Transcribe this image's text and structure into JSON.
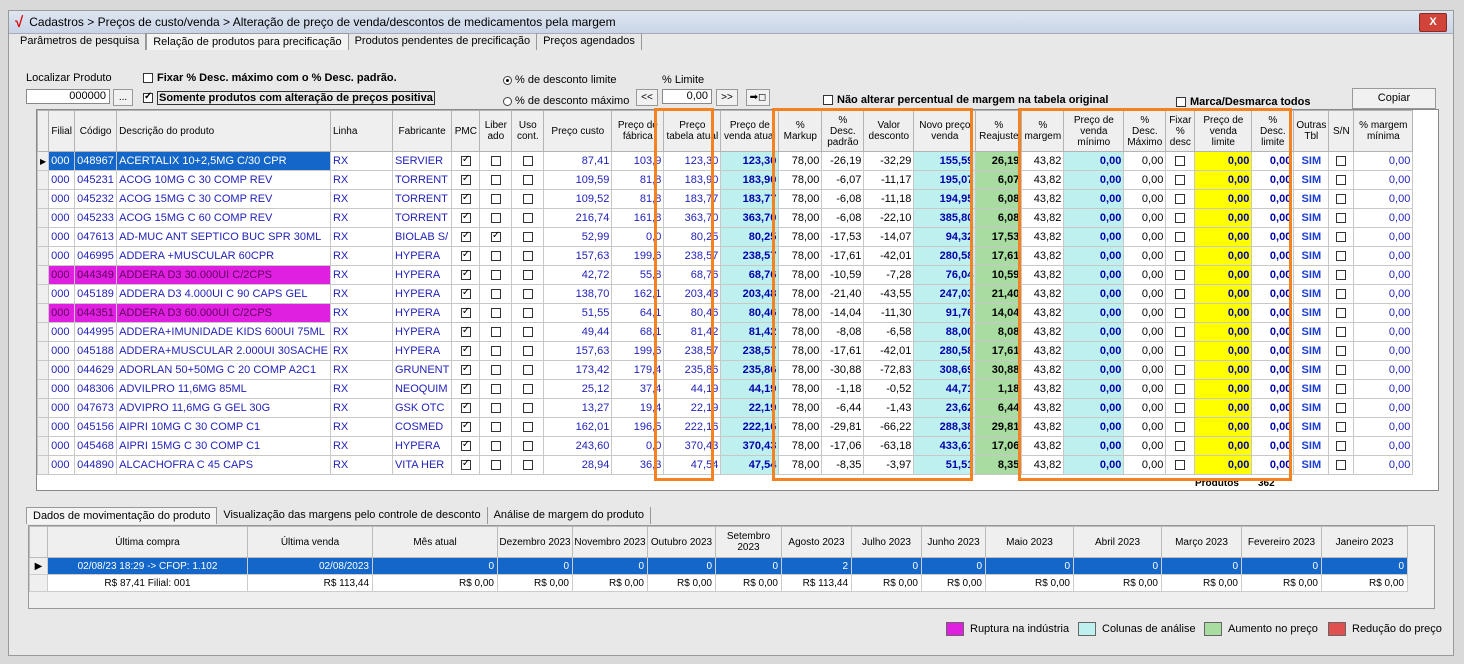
{
  "window": {
    "title": "Cadastros > Preços de custo/venda > Alteração de preço de venda/descontos de medicamentos pela margem",
    "close": "X"
  },
  "tabs": [
    "Parâmetros de pesquisa",
    "Relação de produtos para precificação",
    "Produtos pendentes de precificação",
    "Preços agendados"
  ],
  "filters": {
    "localizar_label": "Localizar Produto",
    "localizar_value": "000000",
    "browse_btn": "...",
    "fixar_desc": "Fixar % Desc. máximo com o % Desc. padrão.",
    "somente_alteracao": "Somente produtos com alteração de preços positiva",
    "radio_limite": "% de desconto limite",
    "radio_maximo": "% de desconto máximo",
    "limite_label": "% Limite",
    "limite_value": "0,00",
    "prev_btn": "<<",
    "next_btn": ">>",
    "apply_btn": "➡◻",
    "nao_alterar": "Não alterar percentual de margem na tabela original",
    "marca_desmarca": "Marca/Desmarca todos",
    "copiar": "Copiar"
  },
  "columns": [
    "Filial",
    "Código",
    "Descrição do produto",
    "Linha",
    "Fabricante",
    "PMC",
    "Liber ado",
    "Uso cont.",
    "Preço custo",
    "Preço de fábrica",
    "Preço tabela atual",
    "Preço de venda atual",
    "% Markup",
    "% Desc. padrão",
    "Valor desconto",
    "Novo preço venda",
    "% Reajuste",
    "% margem",
    "Preço de venda mínimo",
    "% Desc. Máximo",
    "Fixar % desc",
    "Preço de venda limite",
    "% Desc. limite",
    "Outras Tbl",
    "S/N",
    "% margem mínima"
  ],
  "rows": [
    {
      "filial": "000",
      "codigo": "048967",
      "desc": "ACERTALIX 10+2,5MG C/30 CPR",
      "linha": "RX",
      "fab": "SERVIER",
      "pmc": true,
      "lib": false,
      "uso": false,
      "custo": "87,41",
      "fabrica": "103,9",
      "tabela": "123,30",
      "venda": "123,30",
      "markup": "78,00",
      "descp": "-26,19",
      "valdesc": "-32,29",
      "novo": "155,59",
      "reaj": "26,19",
      "margem": "43,82",
      "minimo": "0,00",
      "descmax": "0,00",
      "limite": "0,00",
      "desclim": "0,00",
      "outras": "SIM",
      "mmin": "0,00",
      "rupt": false,
      "selected": true
    },
    {
      "filial": "000",
      "codigo": "045231",
      "desc": "ACOG 10MG C 30 COMP REV",
      "linha": "RX",
      "fab": "TORRENT",
      "pmc": true,
      "lib": false,
      "uso": false,
      "custo": "109,59",
      "fabrica": "81,8",
      "tabela": "183,90",
      "venda": "183,90",
      "markup": "78,00",
      "descp": "-6,07",
      "valdesc": "-11,17",
      "novo": "195,07",
      "reaj": "6,07",
      "margem": "43,82",
      "minimo": "0,00",
      "descmax": "0,00",
      "limite": "0,00",
      "desclim": "0,00",
      "outras": "SIM",
      "mmin": "0,00",
      "rupt": false
    },
    {
      "filial": "000",
      "codigo": "045232",
      "desc": "ACOG 15MG C 30 COMP REV",
      "linha": "RX",
      "fab": "TORRENT",
      "pmc": true,
      "lib": false,
      "uso": false,
      "custo": "109,52",
      "fabrica": "81,8",
      "tabela": "183,77",
      "venda": "183,77",
      "markup": "78,00",
      "descp": "-6,08",
      "valdesc": "-11,18",
      "novo": "194,95",
      "reaj": "6,08",
      "margem": "43,82",
      "minimo": "0,00",
      "descmax": "0,00",
      "limite": "0,00",
      "desclim": "0,00",
      "outras": "SIM",
      "mmin": "0,00",
      "rupt": false
    },
    {
      "filial": "000",
      "codigo": "045233",
      "desc": "ACOG 15MG C 60 COMP REV",
      "linha": "RX",
      "fab": "TORRENT",
      "pmc": true,
      "lib": false,
      "uso": false,
      "custo": "216,74",
      "fabrica": "161,8",
      "tabela": "363,70",
      "venda": "363,70",
      "markup": "78,00",
      "descp": "-6,08",
      "valdesc": "-22,10",
      "novo": "385,80",
      "reaj": "6,08",
      "margem": "43,82",
      "minimo": "0,00",
      "descmax": "0,00",
      "limite": "0,00",
      "desclim": "0,00",
      "outras": "SIM",
      "mmin": "0,00",
      "rupt": false
    },
    {
      "filial": "000",
      "codigo": "047613",
      "desc": "AD-MUC ANT SEPTICO BUC SPR 30ML",
      "linha": "RX",
      "fab": "BIOLAB S/",
      "pmc": true,
      "lib": true,
      "uso": false,
      "custo": "52,99",
      "fabrica": "0,0",
      "tabela": "80,25",
      "venda": "80,25",
      "markup": "78,00",
      "descp": "-17,53",
      "valdesc": "-14,07",
      "novo": "94,32",
      "reaj": "17,53",
      "margem": "43,82",
      "minimo": "0,00",
      "descmax": "0,00",
      "limite": "0,00",
      "desclim": "0,00",
      "outras": "SIM",
      "mmin": "0,00",
      "rupt": false
    },
    {
      "filial": "000",
      "codigo": "046995",
      "desc": "ADDERA +MUSCULAR 60CPR",
      "linha": "RX",
      "fab": "HYPERA",
      "pmc": true,
      "lib": false,
      "uso": false,
      "custo": "157,63",
      "fabrica": "199,6",
      "tabela": "238,57",
      "venda": "238,57",
      "markup": "78,00",
      "descp": "-17,61",
      "valdesc": "-42,01",
      "novo": "280,58",
      "reaj": "17,61",
      "margem": "43,82",
      "minimo": "0,00",
      "descmax": "0,00",
      "limite": "0,00",
      "desclim": "0,00",
      "outras": "SIM",
      "mmin": "0,00",
      "rupt": false
    },
    {
      "filial": "000",
      "codigo": "044349",
      "desc": "ADDERA D3 30.000UI C/2CPS",
      "linha": "RX",
      "fab": "HYPERA",
      "pmc": true,
      "lib": false,
      "uso": false,
      "custo": "42,72",
      "fabrica": "55,8",
      "tabela": "68,76",
      "venda": "68,76",
      "markup": "78,00",
      "descp": "-10,59",
      "valdesc": "-7,28",
      "novo": "76,04",
      "reaj": "10,59",
      "margem": "43,82",
      "minimo": "0,00",
      "descmax": "0,00",
      "limite": "0,00",
      "desclim": "0,00",
      "outras": "SIM",
      "mmin": "0,00",
      "rupt": true
    },
    {
      "filial": "000",
      "codigo": "045189",
      "desc": "ADDERA D3 4.000UI C 90 CAPS GEL",
      "linha": "RX",
      "fab": "HYPERA",
      "pmc": true,
      "lib": false,
      "uso": false,
      "custo": "138,70",
      "fabrica": "162,1",
      "tabela": "203,48",
      "venda": "203,48",
      "markup": "78,00",
      "descp": "-21,40",
      "valdesc": "-43,55",
      "novo": "247,03",
      "reaj": "21,40",
      "margem": "43,82",
      "minimo": "0,00",
      "descmax": "0,00",
      "limite": "0,00",
      "desclim": "0,00",
      "outras": "SIM",
      "mmin": "0,00",
      "rupt": false
    },
    {
      "filial": "000",
      "codigo": "044351",
      "desc": "ADDERA D3 60.000UI C/2CPS",
      "linha": "RX",
      "fab": "HYPERA",
      "pmc": true,
      "lib": false,
      "uso": false,
      "custo": "51,55",
      "fabrica": "64,1",
      "tabela": "80,46",
      "venda": "80,46",
      "markup": "78,00",
      "descp": "-14,04",
      "valdesc": "-11,30",
      "novo": "91,76",
      "reaj": "14,04",
      "margem": "43,82",
      "minimo": "0,00",
      "descmax": "0,00",
      "limite": "0,00",
      "desclim": "0,00",
      "outras": "SIM",
      "mmin": "0,00",
      "rupt": true
    },
    {
      "filial": "000",
      "codigo": "044995",
      "desc": "ADDERA+IMUNIDADE KIDS 600UI 75ML",
      "linha": "RX",
      "fab": "HYPERA",
      "pmc": true,
      "lib": false,
      "uso": false,
      "custo": "49,44",
      "fabrica": "68,1",
      "tabela": "81,42",
      "venda": "81,42",
      "markup": "78,00",
      "descp": "-8,08",
      "valdesc": "-6,58",
      "novo": "88,00",
      "reaj": "8,08",
      "margem": "43,82",
      "minimo": "0,00",
      "descmax": "0,00",
      "limite": "0,00",
      "desclim": "0,00",
      "outras": "SIM",
      "mmin": "0,00",
      "rupt": false
    },
    {
      "filial": "000",
      "codigo": "045188",
      "desc": "ADDERA+MUSCULAR 2.000UI 30SACHE",
      "linha": "RX",
      "fab": "HYPERA",
      "pmc": true,
      "lib": false,
      "uso": false,
      "custo": "157,63",
      "fabrica": "199,6",
      "tabela": "238,57",
      "venda": "238,57",
      "markup": "78,00",
      "descp": "-17,61",
      "valdesc": "-42,01",
      "novo": "280,58",
      "reaj": "17,61",
      "margem": "43,82",
      "minimo": "0,00",
      "descmax": "0,00",
      "limite": "0,00",
      "desclim": "0,00",
      "outras": "SIM",
      "mmin": "0,00",
      "rupt": false
    },
    {
      "filial": "000",
      "codigo": "044629",
      "desc": "ADORLAN 50+50MG C 20 COMP A2C1",
      "linha": "RX",
      "fab": "GRUNENT",
      "pmc": true,
      "lib": false,
      "uso": false,
      "custo": "173,42",
      "fabrica": "179,4",
      "tabela": "235,86",
      "venda": "235,86",
      "markup": "78,00",
      "descp": "-30,88",
      "valdesc": "-72,83",
      "novo": "308,69",
      "reaj": "30,88",
      "margem": "43,82",
      "minimo": "0,00",
      "descmax": "0,00",
      "limite": "0,00",
      "desclim": "0,00",
      "outras": "SIM",
      "mmin": "0,00",
      "rupt": false
    },
    {
      "filial": "000",
      "codigo": "048306",
      "desc": "ADVILPRO 11,6MG 85ML",
      "linha": "RX",
      "fab": "NEOQUIM",
      "pmc": true,
      "lib": false,
      "uso": false,
      "custo": "25,12",
      "fabrica": "37,4",
      "tabela": "44,19",
      "venda": "44,19",
      "markup": "78,00",
      "descp": "-1,18",
      "valdesc": "-0,52",
      "novo": "44,71",
      "reaj": "1,18",
      "margem": "43,82",
      "minimo": "0,00",
      "descmax": "0,00",
      "limite": "0,00",
      "desclim": "0,00",
      "outras": "SIM",
      "mmin": "0,00",
      "rupt": false
    },
    {
      "filial": "000",
      "codigo": "047673",
      "desc": "ADVIPRO 11,6MG G GEL 30G",
      "linha": "RX",
      "fab": "GSK OTC",
      "pmc": true,
      "lib": false,
      "uso": false,
      "custo": "13,27",
      "fabrica": "19,4",
      "tabela": "22,19",
      "venda": "22,19",
      "markup": "78,00",
      "descp": "-6,44",
      "valdesc": "-1,43",
      "novo": "23,62",
      "reaj": "6,44",
      "margem": "43,82",
      "minimo": "0,00",
      "descmax": "0,00",
      "limite": "0,00",
      "desclim": "0,00",
      "outras": "SIM",
      "mmin": "0,00",
      "rupt": false
    },
    {
      "filial": "000",
      "codigo": "045156",
      "desc": "AIPRI 10MG C 30 COMP C1",
      "linha": "RX",
      "fab": "COSMED",
      "pmc": true,
      "lib": false,
      "uso": false,
      "custo": "162,01",
      "fabrica": "196,5",
      "tabela": "222,16",
      "venda": "222,16",
      "markup": "78,00",
      "descp": "-29,81",
      "valdesc": "-66,22",
      "novo": "288,38",
      "reaj": "29,81",
      "margem": "43,82",
      "minimo": "0,00",
      "descmax": "0,00",
      "limite": "0,00",
      "desclim": "0,00",
      "outras": "SIM",
      "mmin": "0,00",
      "rupt": false
    },
    {
      "filial": "000",
      "codigo": "045468",
      "desc": "AIPRI 15MG C 30 COMP C1",
      "linha": "RX",
      "fab": "HYPERA",
      "pmc": true,
      "lib": false,
      "uso": false,
      "custo": "243,60",
      "fabrica": "0,0",
      "tabela": "370,43",
      "venda": "370,43",
      "markup": "78,00",
      "descp": "-17,06",
      "valdesc": "-63,18",
      "novo": "433,61",
      "reaj": "17,06",
      "margem": "43,82",
      "minimo": "0,00",
      "descmax": "0,00",
      "limite": "0,00",
      "desclim": "0,00",
      "outras": "SIM",
      "mmin": "0,00",
      "rupt": false
    },
    {
      "filial": "000",
      "codigo": "044890",
      "desc": "ALCACHOFRA C 45 CAPS",
      "linha": "RX",
      "fab": "VITA HER",
      "pmc": true,
      "lib": false,
      "uso": false,
      "custo": "28,94",
      "fabrica": "36,3",
      "tabela": "47,54",
      "venda": "47,54",
      "markup": "78,00",
      "descp": "-8,35",
      "valdesc": "-3,97",
      "novo": "51,51",
      "reaj": "8,35",
      "margem": "43,82",
      "minimo": "0,00",
      "descmax": "0,00",
      "limite": "0,00",
      "desclim": "0,00",
      "outras": "SIM",
      "mmin": "0,00",
      "rupt": false
    }
  ],
  "footer": {
    "produtos_label": "Produtos",
    "produtos_count": "362"
  },
  "bottom_tabs": [
    "Dados de movimentação do produto",
    "Visualização das margens pelo controle de desconto",
    "Análise de margem do produto"
  ],
  "bottom_columns": [
    "Última compra",
    "Última venda",
    "Mês atual",
    "Dezembro 2023",
    "Novembro 2023",
    "Outubro 2023",
    "Setembro 2023",
    "Agosto 2023",
    "Julho 2023",
    "Junho 2023",
    "Maio 2023",
    "Abril 2023",
    "Março 2023",
    "Fevereiro 2023",
    "Janeiro 2023"
  ],
  "bottom_row1": [
    "02/08/23 18:29 -> CFOP: 1.102",
    "02/08/2023",
    "0",
    "0",
    "0",
    "0",
    "0",
    "2",
    "0",
    "0",
    "0",
    "0",
    "0",
    "0",
    "0"
  ],
  "bottom_row2": [
    "R$ 87,41 Filial: 001",
    "R$ 113,44",
    "R$ 0,00",
    "R$ 0,00",
    "R$ 0,00",
    "R$ 0,00",
    "R$ 0,00",
    "R$ 113,44",
    "R$ 0,00",
    "R$ 0,00",
    "R$ 0,00",
    "R$ 0,00",
    "R$ 0,00",
    "R$ 0,00",
    "R$ 0,00"
  ],
  "legend": [
    {
      "label": "Ruptura na indústria",
      "color": "#e020e0"
    },
    {
      "label": "Colunas de análise",
      "color": "#bff0f0"
    },
    {
      "label": "Aumento no preço",
      "color": "#a8dca0"
    },
    {
      "label": "Redução do preço",
      "color": "#e05050"
    }
  ],
  "colors": {
    "highlight": "#f58220",
    "selected": "#1467c8",
    "cyan": "#bff0f0",
    "yellow": "#ffff00"
  }
}
